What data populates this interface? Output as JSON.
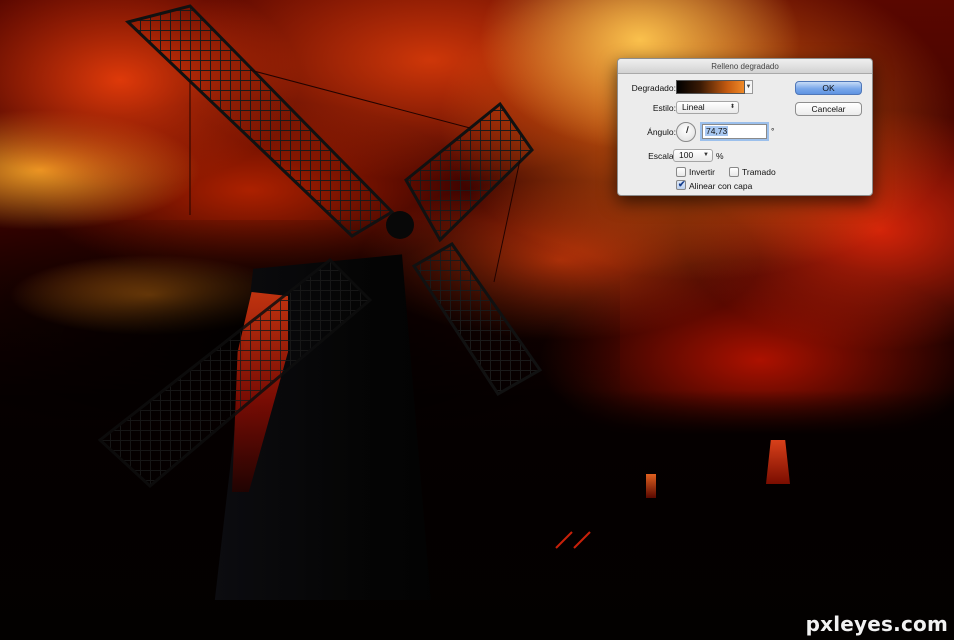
{
  "dialog": {
    "title": "Relleno degradado",
    "gradient_label": "Degradado:",
    "style_label": "Estilo:",
    "style_value": "Lineal",
    "angle_label": "Ángulo:",
    "angle_value": "74,73",
    "angle_unit": "°",
    "scale_label": "Escala:",
    "scale_value": "100",
    "scale_unit": "%",
    "reverse_label": "Invertir",
    "reverse_checked": false,
    "dither_label": "Tramado",
    "dither_checked": false,
    "align_label": "Alinear con capa",
    "align_checked": true,
    "ok_label": "OK",
    "cancel_label": "Cancelar",
    "gradient_colors": [
      "#000000",
      "#f08a28"
    ]
  },
  "watermark": "pxleyes.com",
  "colors": {
    "dialog_bg": "#ececec",
    "default_button": "#6d9ee6",
    "sky_glow": "#ff8c1e",
    "sky_dark": "#3b0300"
  },
  "icons": {
    "dropdown": "chevron-down-icon",
    "checkbox_checked": "checkmark-icon",
    "angle_dial": "angle-dial-icon"
  }
}
